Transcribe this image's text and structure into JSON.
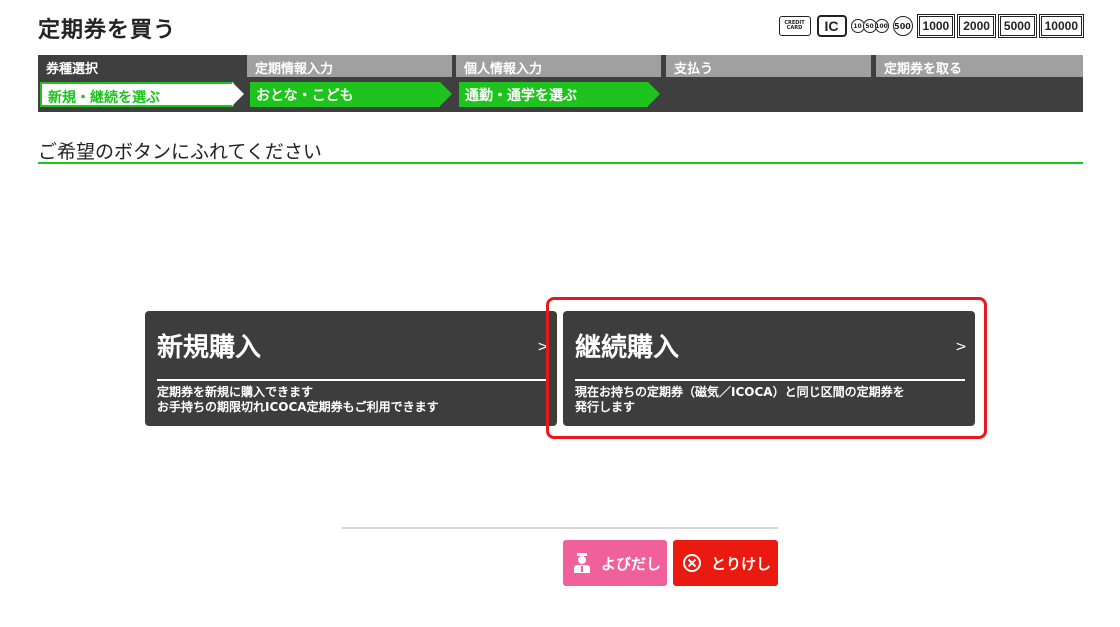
{
  "header": {
    "title": "定期券を買う"
  },
  "payment_icons": {
    "credit_card": "CREDIT CARD",
    "ic": "IC",
    "coins": [
      "10",
      "50",
      "100"
    ],
    "coin_500": "500",
    "bills": [
      "1000",
      "2000",
      "5000",
      "10000"
    ]
  },
  "steps": {
    "tabs": [
      "券種選択",
      "定期情報入力",
      "個人情報入力",
      "支払う",
      "定期券を取る"
    ],
    "substeps": [
      "新規・継続を選ぶ",
      "おとな・こども",
      "通勤・通学を選ぶ"
    ]
  },
  "instruction": "ご希望のボタンにふれてください",
  "options": [
    {
      "title": "新規購入",
      "chevron": ">",
      "desc_line1": "定期券を新規に購入できます",
      "desc_line2": "お手持ちの期限切れICOCA定期券もご利用できます"
    },
    {
      "title": "継続購入",
      "chevron": ">",
      "desc_line1": "現在お持ちの定期券（磁気／ICOCA）と同じ区間の定期券を",
      "desc_line2": "発行します"
    }
  ],
  "buttons": {
    "call": "よびだし",
    "cancel": "とりけし"
  },
  "colors": {
    "accent_green": "#1ec31e",
    "dark_panel": "#3d3d3d",
    "highlight_red": "#e8181f",
    "call_pink": "#f0609a",
    "cancel_red": "#ea1a10"
  }
}
